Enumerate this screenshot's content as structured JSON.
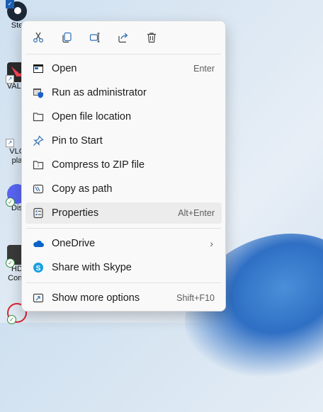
{
  "desktop": {
    "icons": [
      {
        "label": "Ste"
      },
      {
        "label": "VALO"
      },
      {
        "label": "VLC"
      },
      {
        "label": "pla"
      },
      {
        "label": "Dis"
      },
      {
        "label": "HD"
      },
      {
        "label": "Conv"
      }
    ]
  },
  "context_menu": {
    "toolbar": [
      "cut-icon",
      "copy-icon",
      "rename-icon",
      "share-icon",
      "delete-icon"
    ],
    "items": [
      {
        "label": "Open",
        "shortcut": "Enter",
        "icon": "open-icon"
      },
      {
        "label": "Run as administrator",
        "shortcut": "",
        "icon": "shield-icon"
      },
      {
        "label": "Open file location",
        "shortcut": "",
        "icon": "folder-icon"
      },
      {
        "label": "Pin to Start",
        "shortcut": "",
        "icon": "pin-icon"
      },
      {
        "label": "Compress to ZIP file",
        "shortcut": "",
        "icon": "zip-icon"
      },
      {
        "label": "Copy as path",
        "shortcut": "",
        "icon": "path-icon"
      },
      {
        "label": "Properties",
        "shortcut": "Alt+Enter",
        "icon": "properties-icon"
      },
      {
        "label": "OneDrive",
        "shortcut": "",
        "icon": "onedrive-icon"
      },
      {
        "label": "Share with Skype",
        "shortcut": "",
        "icon": "skype-icon"
      },
      {
        "label": "Show more options",
        "shortcut": "Shift+F10",
        "icon": "more-options-icon"
      }
    ]
  },
  "colors": {
    "accent": "#0067c0",
    "menu_bg": "#f9f9f9",
    "hover_bg": "#ececec",
    "skype": "#1aa0e0",
    "onedrive": "#0a64c8"
  }
}
